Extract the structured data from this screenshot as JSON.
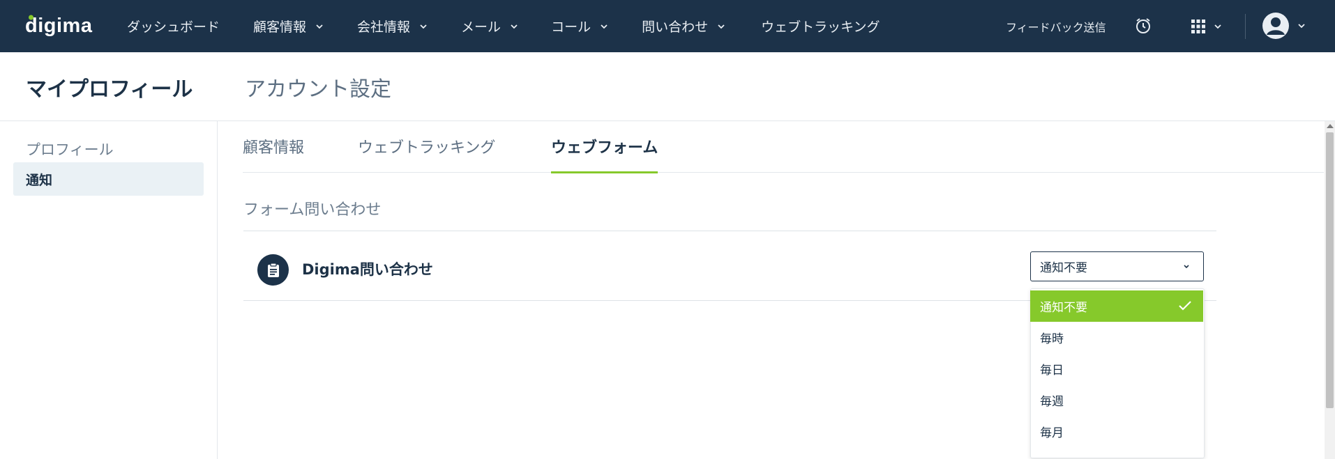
{
  "app": {
    "logo_text": "digima"
  },
  "nav": {
    "items": [
      {
        "label": "ダッシュボード",
        "has_dropdown": false
      },
      {
        "label": "顧客情報",
        "has_dropdown": true
      },
      {
        "label": "会社情報",
        "has_dropdown": true
      },
      {
        "label": "メール",
        "has_dropdown": true
      },
      {
        "label": "コール",
        "has_dropdown": true
      },
      {
        "label": "問い合わせ",
        "has_dropdown": true
      },
      {
        "label": "ウェブトラッキング",
        "has_dropdown": false
      }
    ],
    "feedback_label": "フィードバック送信",
    "icons": [
      "alarm-clock-icon",
      "apps-grid-icon",
      "user-avatar-icon"
    ]
  },
  "header": {
    "title": "マイプロフィール",
    "subtitle": "アカウント設定"
  },
  "sidebar": {
    "items": [
      {
        "label": "プロフィール",
        "active": false
      },
      {
        "label": "通知",
        "active": true
      }
    ]
  },
  "tabs": [
    {
      "label": "顧客情報",
      "active": false
    },
    {
      "label": "ウェブトラッキング",
      "active": false
    },
    {
      "label": "ウェブフォーム",
      "active": true
    }
  ],
  "section": {
    "title": "フォーム問い合わせ",
    "form": {
      "name": "Digima問い合わせ",
      "icon": "clipboard-icon",
      "selected_value": "通知不要"
    }
  },
  "dropdown": {
    "options": [
      {
        "label": "通知不要",
        "selected": true
      },
      {
        "label": "毎時",
        "selected": false
      },
      {
        "label": "毎日",
        "selected": false
      },
      {
        "label": "毎週",
        "selected": false
      },
      {
        "label": "毎月",
        "selected": false
      }
    ]
  },
  "colors": {
    "navbar": "#1c3249",
    "accent": "#86c92b",
    "active_sidebar_bg": "#eaf1f5"
  }
}
